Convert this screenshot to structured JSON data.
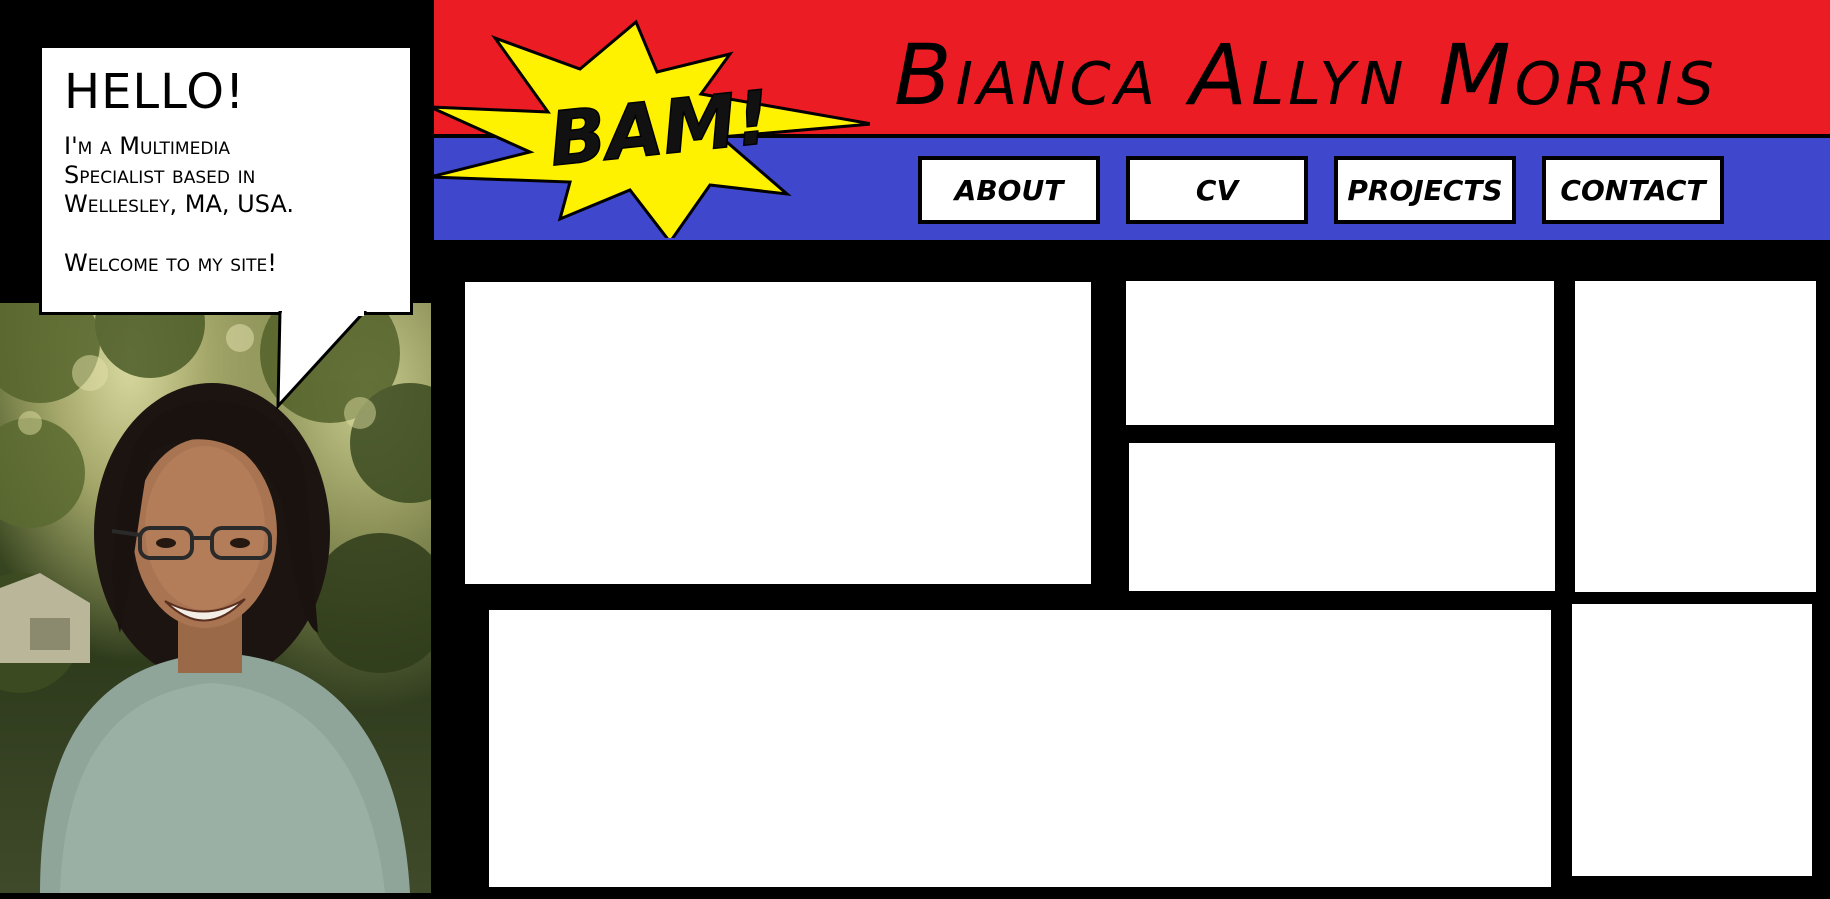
{
  "site": {
    "title": "Bianca Allyn Morris",
    "burst_text": "BAM!"
  },
  "bubble": {
    "greeting": "Hello!",
    "intro": "I'm a Multimedia\nSpecialist based in\nWellesley, MA, USA.",
    "welcome": "Welcome to my site!"
  },
  "nav": {
    "items": [
      {
        "label": "About"
      },
      {
        "label": "CV"
      },
      {
        "label": "Projects"
      },
      {
        "label": "Contact"
      }
    ]
  },
  "colors": {
    "header_red": "#ec1c24",
    "header_blue": "#3f48cc",
    "burst_yellow": "#fff200",
    "background": "#000000",
    "panel": "#ffffff"
  }
}
